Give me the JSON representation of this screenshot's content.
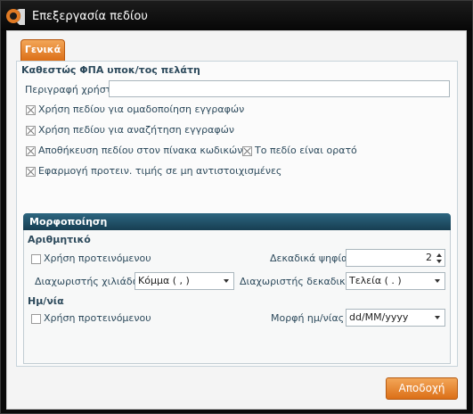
{
  "window": {
    "title": "Επεξεργασία πεδίου"
  },
  "tabs": [
    {
      "label": "Γενικά",
      "active": true
    }
  ],
  "general": {
    "heading": "Καθεστώς ΦΠΑ υποκ/τος πελάτη",
    "user_description": {
      "label": "Περιγραφή χρήστη",
      "value": ""
    },
    "checkboxes": [
      {
        "label": "Χρήση πεδίου για ομαδοποίηση εγγραφών",
        "checked": true
      },
      {
        "label": "Χρήση πεδίου για αναζήτηση εγγραφών",
        "checked": true
      },
      {
        "label": "Αποθήκευση πεδίου στον πίνακα κωδικών",
        "checked": true
      },
      {
        "label": "Το πεδίο είναι ορατό",
        "checked": true
      },
      {
        "label": "Εφαρμογή προτειν. τιμής σε μη αντιστοιχισμένες",
        "checked": true
      }
    ]
  },
  "formatting": {
    "title": "Μορφοποίηση",
    "numeric": {
      "heading": "Αριθμητικό",
      "use_default": {
        "label": "Χρήση προτεινόμενου",
        "checked": false
      },
      "decimals": {
        "label": "Δεκαδικά ψηφία",
        "value": "2"
      },
      "thousands_sep": {
        "label": "Διαχωριστής χιλιάδων",
        "value": "Κόμμα ( , )"
      },
      "decimal_sep": {
        "label": "Διαχωριστής δεκαδικών",
        "value": "Τελεία ( . )"
      }
    },
    "date": {
      "heading": "Ημ/νία",
      "use_default": {
        "label": "Χρήση προτεινόμενου",
        "checked": false
      },
      "format": {
        "label": "Μορφή ημ/νίας",
        "value": "dd/MM/yyyy"
      }
    }
  },
  "buttons": {
    "ok": "Αποδοχή"
  },
  "colors": {
    "accent": "#e07a24",
    "header": "#1f4d63",
    "window_bg": "#0a0a0a"
  },
  "icons": {
    "app": "app-logo-icon"
  }
}
